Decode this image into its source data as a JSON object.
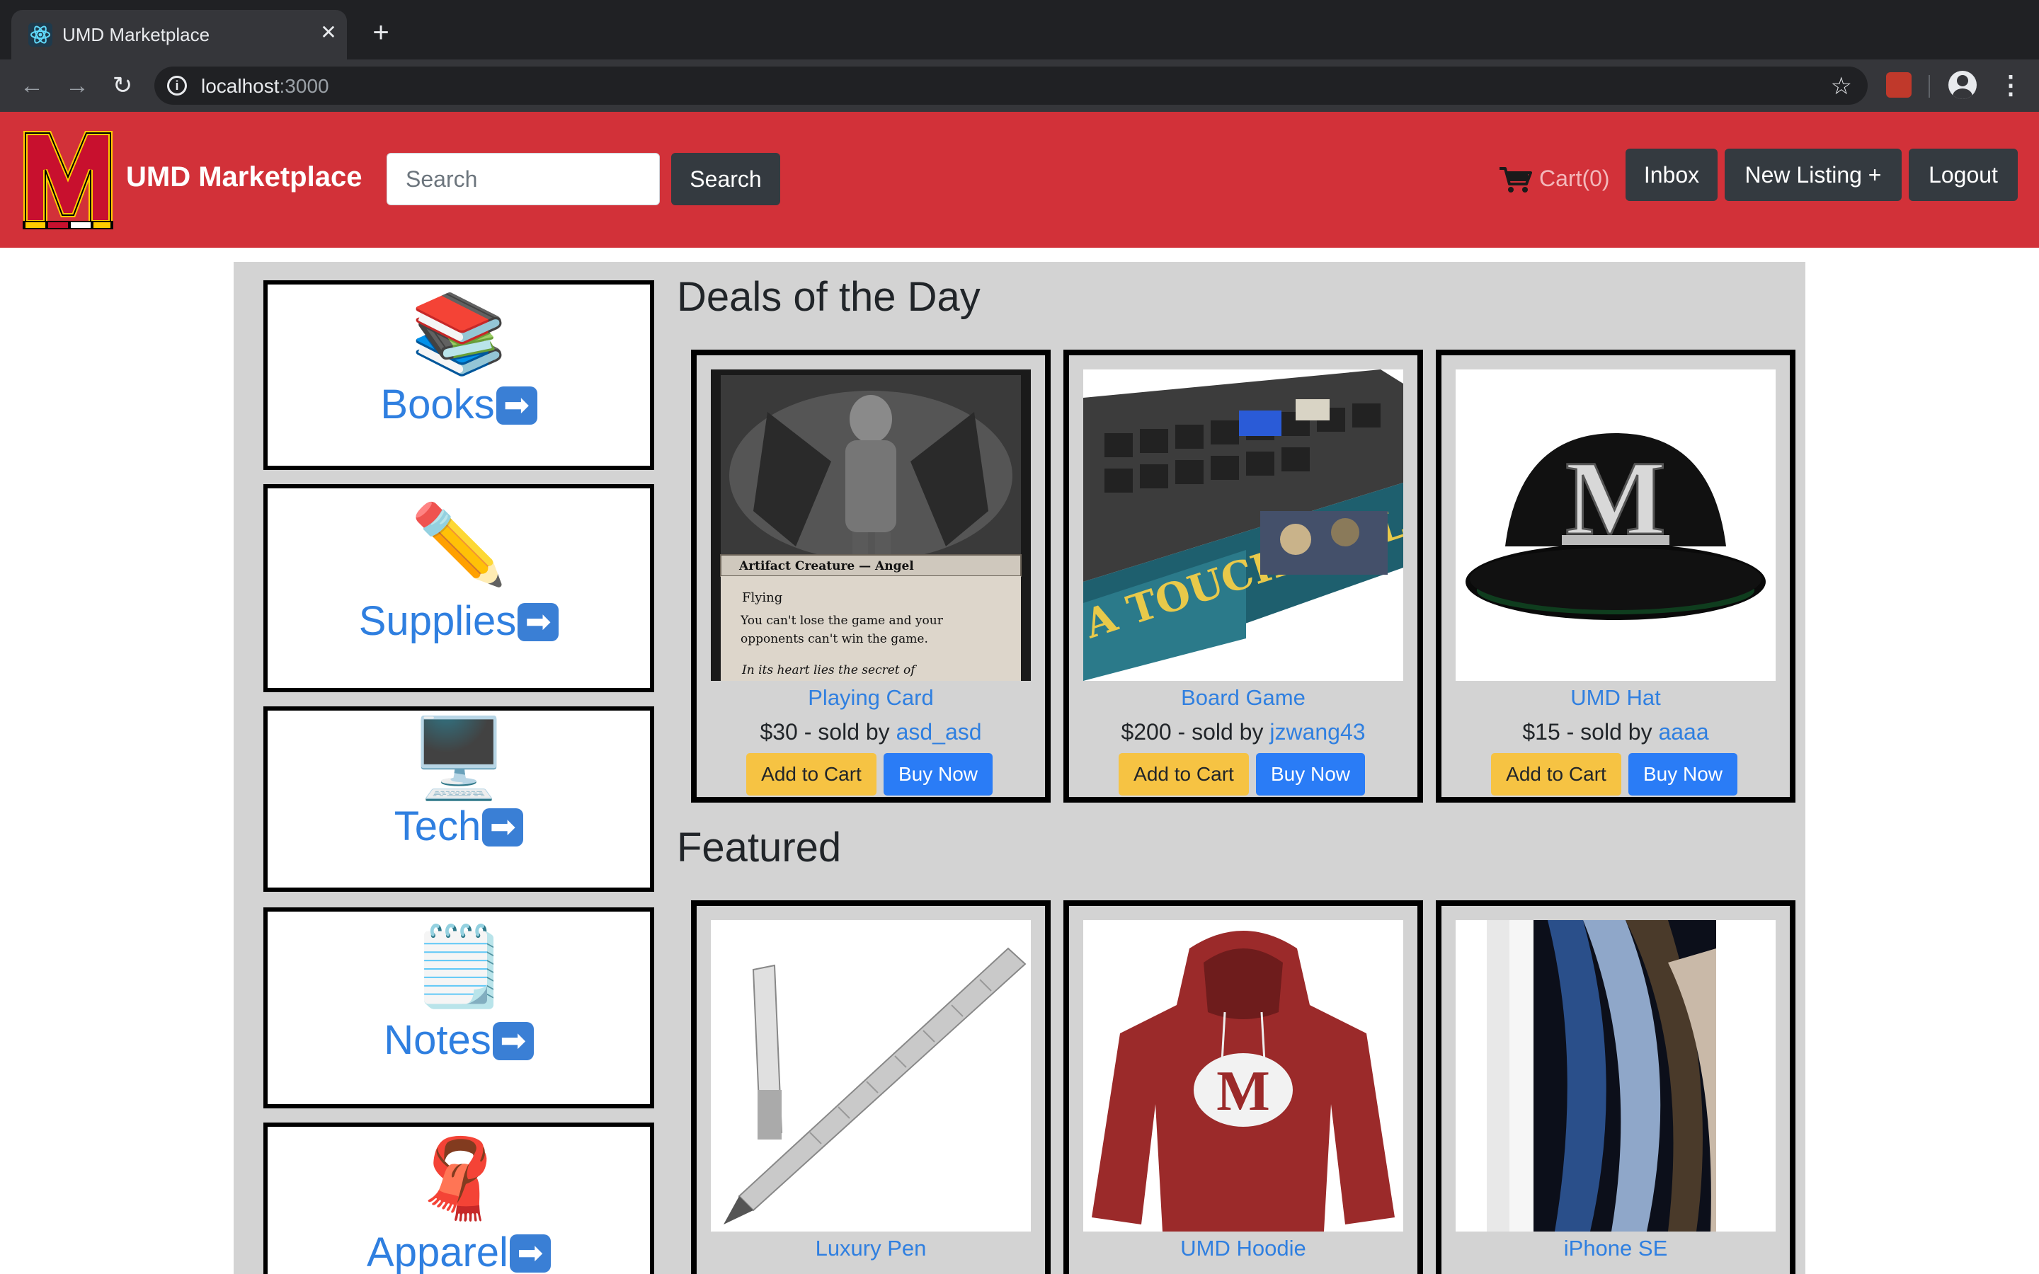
{
  "browser": {
    "tab_title": "UMD Marketplace",
    "url_host": "localhost",
    "url_port": ":3000"
  },
  "navbar": {
    "brand": "UMD Marketplace",
    "search_placeholder": "Search",
    "search_button": "Search",
    "cart_label": "Cart(0)",
    "inbox_button": "Inbox",
    "new_listing_button": "New Listing +",
    "logout_button": "Logout",
    "brand_color": "#d23139"
  },
  "categories": [
    {
      "label": "Books",
      "icon": "books-icon",
      "emoji": "📚"
    },
    {
      "label": "Supplies",
      "icon": "pencil-icon",
      "emoji": "✏️"
    },
    {
      "label": "Tech",
      "icon": "computer-icon",
      "emoji": "🖥️"
    },
    {
      "label": "Notes",
      "icon": "notepad-icon",
      "emoji": "🗒️"
    },
    {
      "label": "Apparel",
      "icon": "scarf-icon",
      "emoji": "🧣"
    }
  ],
  "deals": {
    "title": "Deals of the Day",
    "items": [
      {
        "name": "Playing Card",
        "price": "$30",
        "sold_by_text": " - sold by ",
        "seller": "asd_asd",
        "image": "playing-card-image",
        "card_line1": "Artifact Creature — Angel",
        "card_line2": "Flying",
        "card_line3": "You can't lose the game and your opponents can't win the game.",
        "card_line4": "In its heart lies the secret of"
      },
      {
        "name": "Board Game",
        "price": "$200",
        "sold_by_text": " - sold by ",
        "seller": "jzwang43",
        "image": "board-game-image",
        "box_text": "A TOUCH EVIL"
      },
      {
        "name": "UMD Hat",
        "price": "$15",
        "sold_by_text": " - sold by ",
        "seller": "aaaa",
        "image": "umd-hat-image",
        "logo_letter": "M"
      }
    ]
  },
  "featured": {
    "title": "Featured",
    "items": [
      {
        "name": "Luxury Pen",
        "image": "luxury-pen-image"
      },
      {
        "name": "UMD Hoodie",
        "image": "umd-hoodie-image",
        "logo_letter": "M"
      },
      {
        "name": "iPhone SE",
        "image": "iphone-se-image"
      }
    ]
  },
  "buttons": {
    "add_to_cart": "Add to Cart",
    "buy_now": "Buy Now"
  }
}
